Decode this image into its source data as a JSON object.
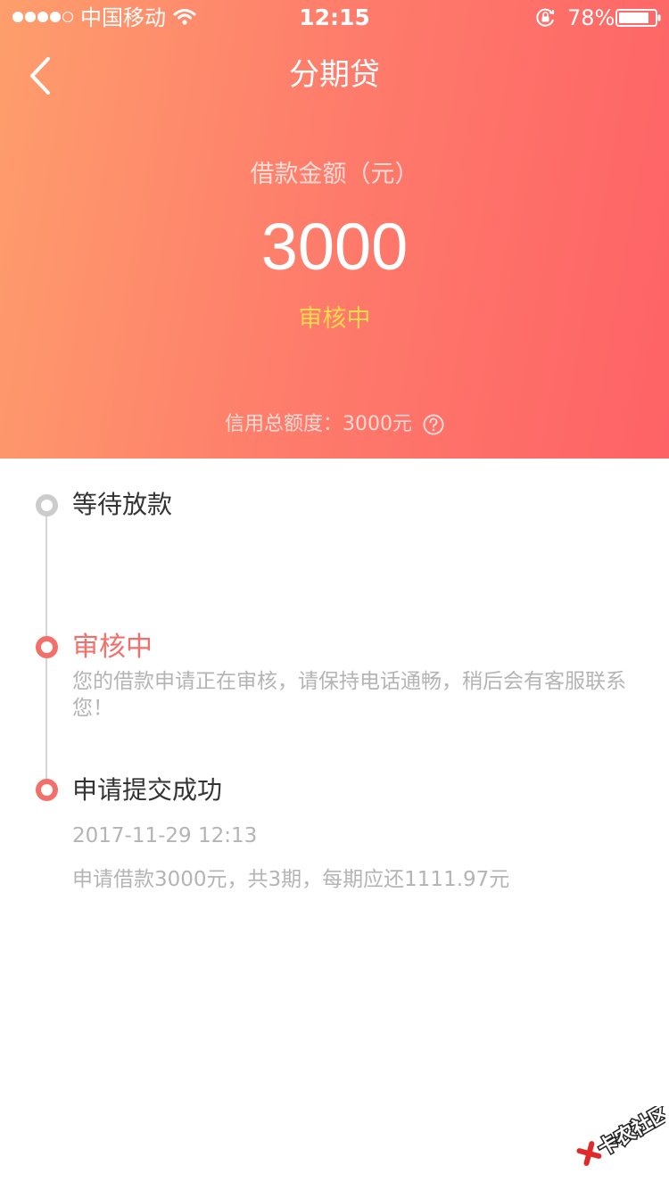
{
  "status_bar": {
    "carrier": "中国移动",
    "time": "12:15",
    "battery": "78%"
  },
  "nav": {
    "title": "分期贷"
  },
  "loan": {
    "amount_label": "借款金额（元）",
    "amount": "3000",
    "status": "审核中",
    "credit_limit": "信用总额度：3000元"
  },
  "timeline": [
    {
      "title": "等待放款",
      "state": "pending"
    },
    {
      "title": "审核中",
      "state": "active",
      "desc": "您的借款申请正在审核，请保持电话通畅，稍后会有客服联系您！"
    },
    {
      "title": "申请提交成功",
      "state": "done",
      "date": "2017-11-29 12:13",
      "desc": "申请借款3000元，共3期，每期应还1111.97元"
    }
  ],
  "watermark": {
    "text": "卡农社区"
  },
  "colors": {
    "gradient_start": "#fe9e6c",
    "gradient_end": "#fe6266",
    "status_yellow": "#fcd84e",
    "accent_red": "#f36f6a"
  }
}
